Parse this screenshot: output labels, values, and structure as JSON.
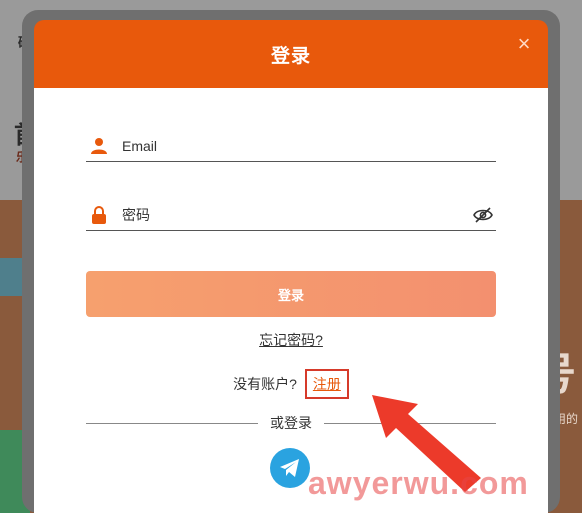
{
  "background": {
    "fragment_top": "码",
    "fragment_mid": "首",
    "fragment_small": "乐的",
    "fragment_right": "号",
    "fragment_right_small": "用的"
  },
  "modal": {
    "title": "登录",
    "close_symbol": "×",
    "email_placeholder": "Email",
    "password_placeholder": "密码",
    "login_button": "登录",
    "forgot_password": "忘记密码?",
    "no_account": "没有账户?",
    "register_link": "注册",
    "or_login": "或登录"
  },
  "icons": {
    "user": "user-icon",
    "lock": "lock-icon",
    "eye_off": "eye-off-icon",
    "telegram": "telegram-icon",
    "close": "close-icon"
  },
  "colors": {
    "header": "#e8590c",
    "login_button": "#f6a06e",
    "register_box": "#d63a2a",
    "telegram": "#2aa3e0",
    "arrow": "#ec3a2a",
    "watermark": "#e84646"
  },
  "watermark": "awyerwu.com"
}
